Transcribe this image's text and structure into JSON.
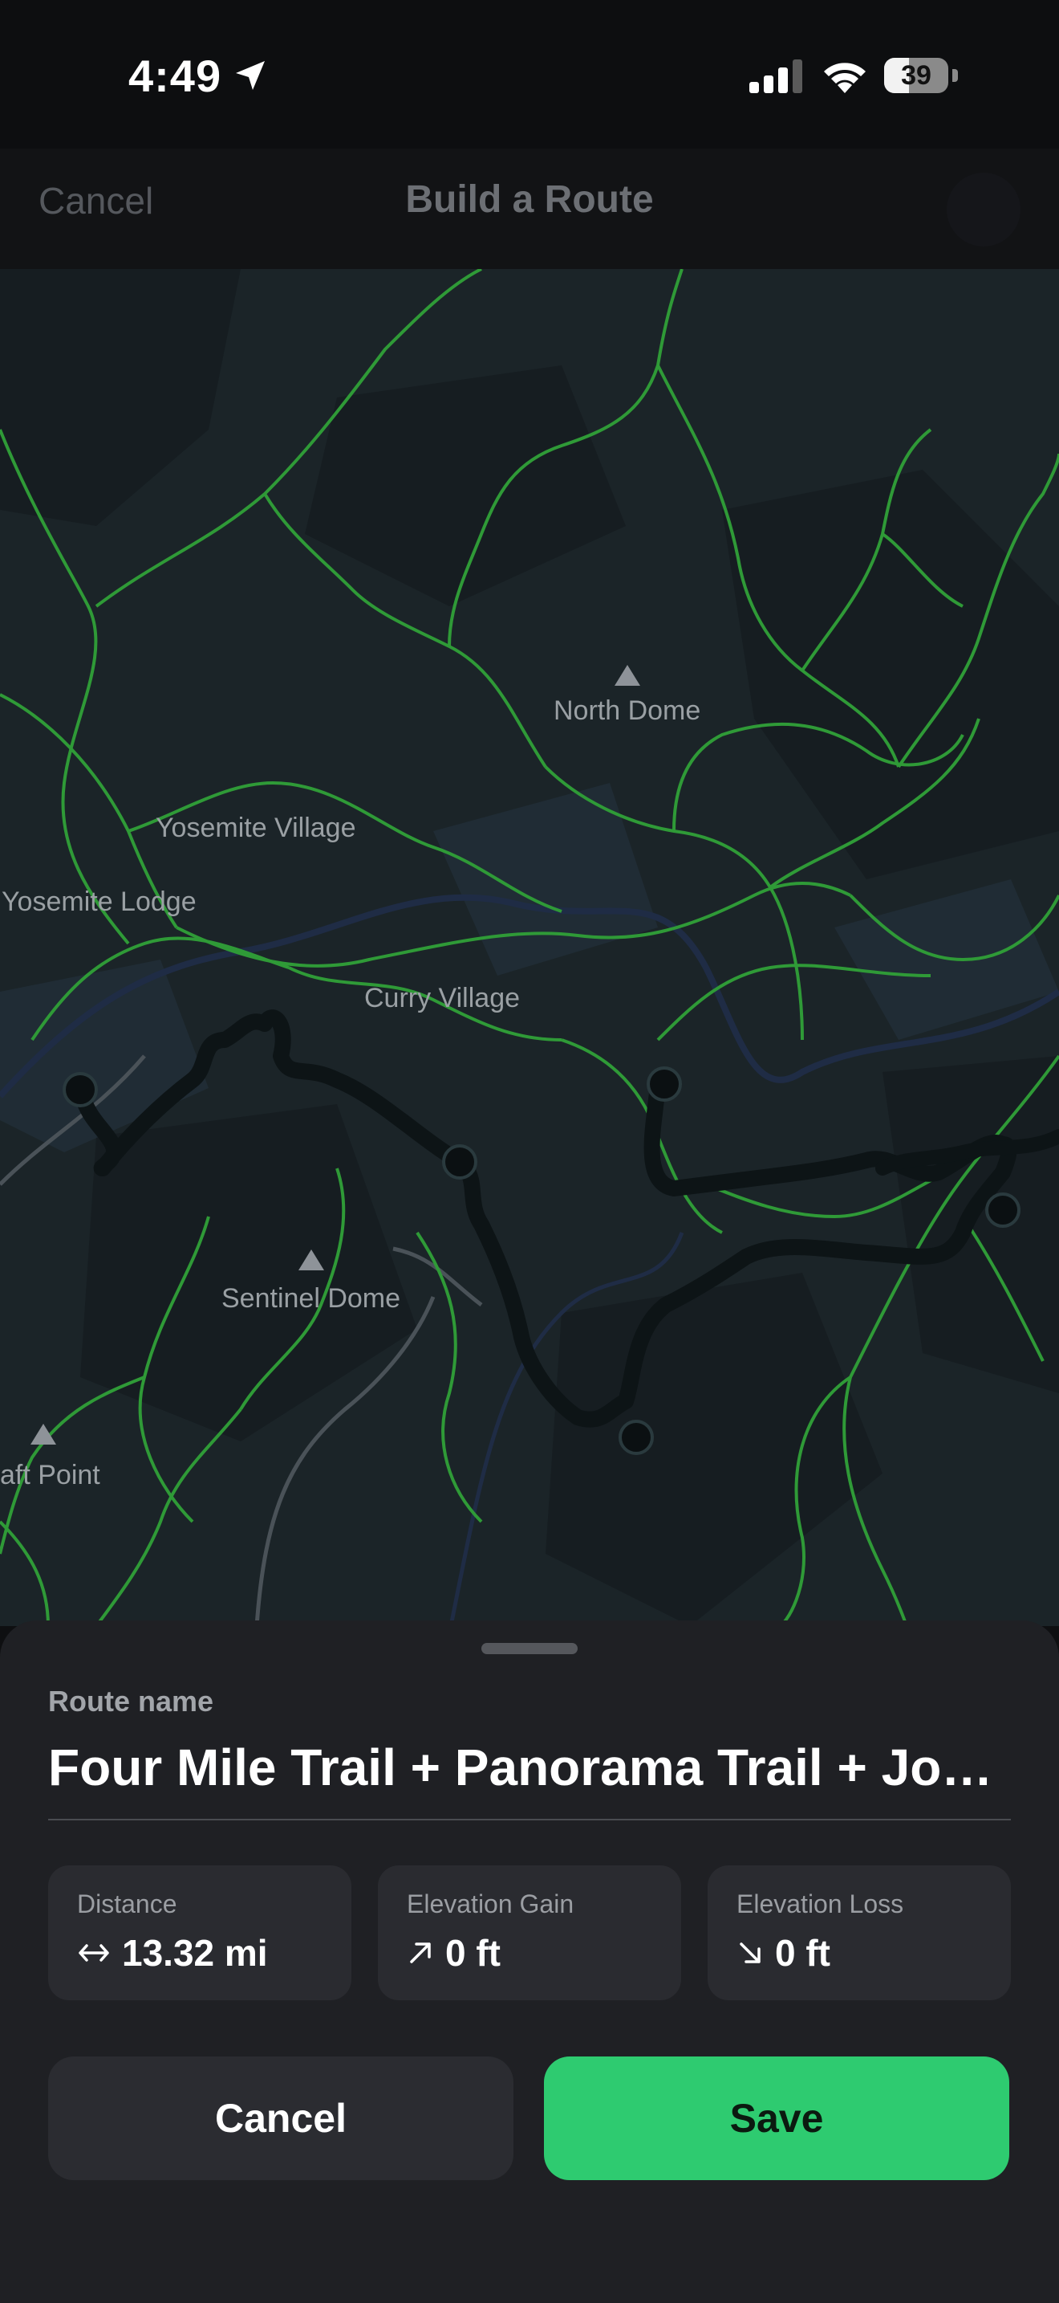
{
  "status_bar": {
    "time": "4:49",
    "battery": "39",
    "battery_level": 0.39
  },
  "nav": {
    "cancel_label": "Cancel",
    "title": "Build a Route"
  },
  "map": {
    "labels": {
      "north_dome": "North Dome",
      "yosemite_village": "Yosemite Village",
      "yosemite_lodge": "Yosemite Lodge",
      "curry_village": "Curry Village",
      "sentinel_dome": "Sentinel Dome",
      "taft_point": "aft Point"
    },
    "colors": {
      "trail": "#2f9a37",
      "route": "#0d1416",
      "background": "#1b2428"
    }
  },
  "sheet": {
    "route_name_label": "Route name",
    "route_name": "Four Mile Trail + Panorama Trail + John Muir Trail",
    "stats": [
      {
        "label": "Distance",
        "value": "13.32 mi",
        "icon": "horizontal-arrows-icon"
      },
      {
        "label": "Elevation Gain",
        "value": "0 ft",
        "icon": "arrow-up-right-icon"
      },
      {
        "label": "Elevation Loss",
        "value": "0 ft",
        "icon": "arrow-down-right-icon"
      }
    ],
    "cancel_label": "Cancel",
    "save_label": "Save",
    "save_color": "#2ecb70"
  }
}
